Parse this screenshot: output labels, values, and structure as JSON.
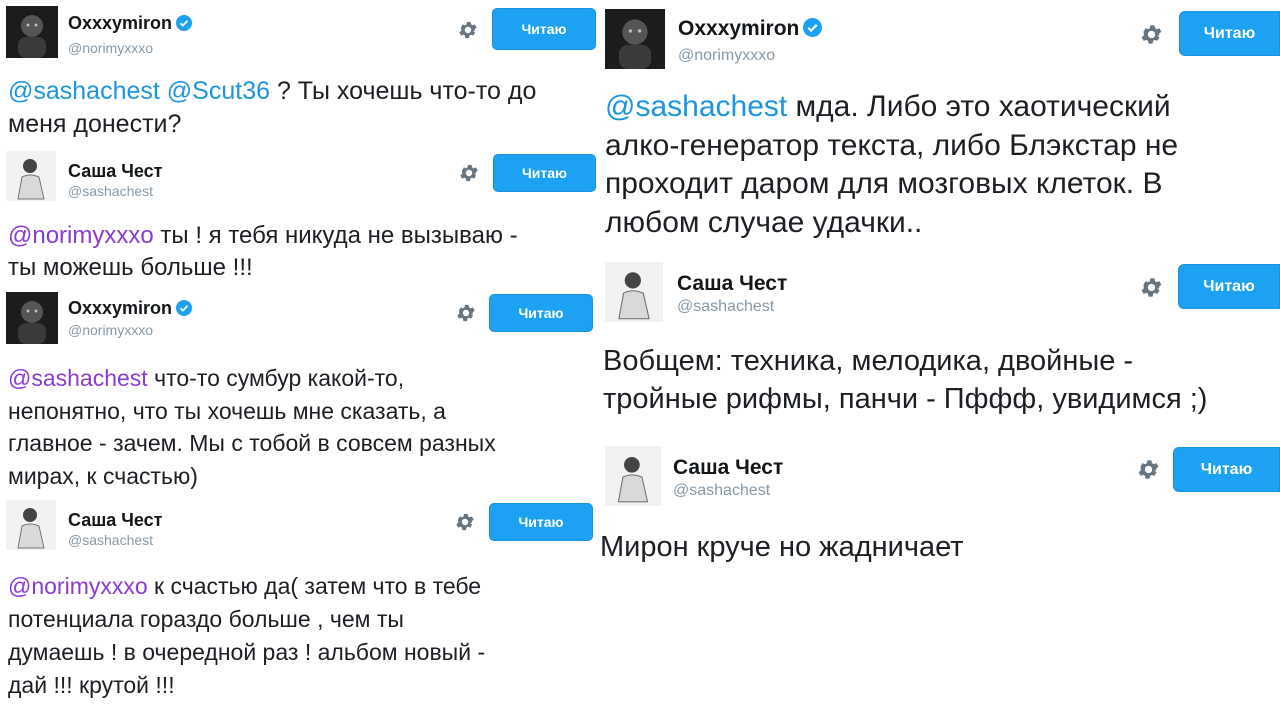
{
  "users": {
    "oxxxy": {
      "name": "Oxxxymiron",
      "handle": "@norimyxxxo",
      "verified": true,
      "avatar_icon": "dark-portrait-avatar"
    },
    "sasha": {
      "name": "Саша Чест",
      "handle": "@sashachest",
      "verified": false,
      "avatar_icon": "light-portrait-avatar"
    }
  },
  "follow_label": "Читаю",
  "colors": {
    "follow_bg": "#1da1f2",
    "mention_blue": "#1b95e0",
    "mention_purple": "#8a3bd1",
    "handle_gray": "#8899a6"
  },
  "tweets": [
    {
      "mentions": [
        "@sashachest",
        "@Scut36"
      ],
      "body": " ? Ты хочешь что-то до\nменя донести?"
    },
    {
      "mentions": [
        "@norimyxxxo"
      ],
      "body": " ты ! я тебя никуда не вызываю -\nты можешь больше !!!"
    },
    {
      "mentions": [
        "@sashachest"
      ],
      "body": " что-то сумбур какой-то,\nнепонятно, что ты хочешь мне сказать, а\nглавное - зачем. Мы с тобой в совсем разных\nмирах, к счастью)"
    },
    {
      "mentions": [
        "@norimyxxxo"
      ],
      "body": " к счастью да( затем что в тебе\nпотенциала гораздо больше , чем ты\nдумаешь ! в очередной раз ! альбом новый -\nдай !!! крутой !!!"
    },
    {
      "mentions": [
        "@sashachest"
      ],
      "body": " мда. Либо это хаотический\nалко-генератор текста, либо Блэкстар не\nпроходит даром для мозговых клеток. В\nлюбом случае удачки.."
    },
    {
      "mentions": [],
      "body": "Вобщем: техника, мелодика, двойные -\nтройные рифмы, панчи - Пффф, увидимся ;)"
    },
    {
      "mentions": [],
      "body": "Мирон круче но жадничает"
    }
  ]
}
